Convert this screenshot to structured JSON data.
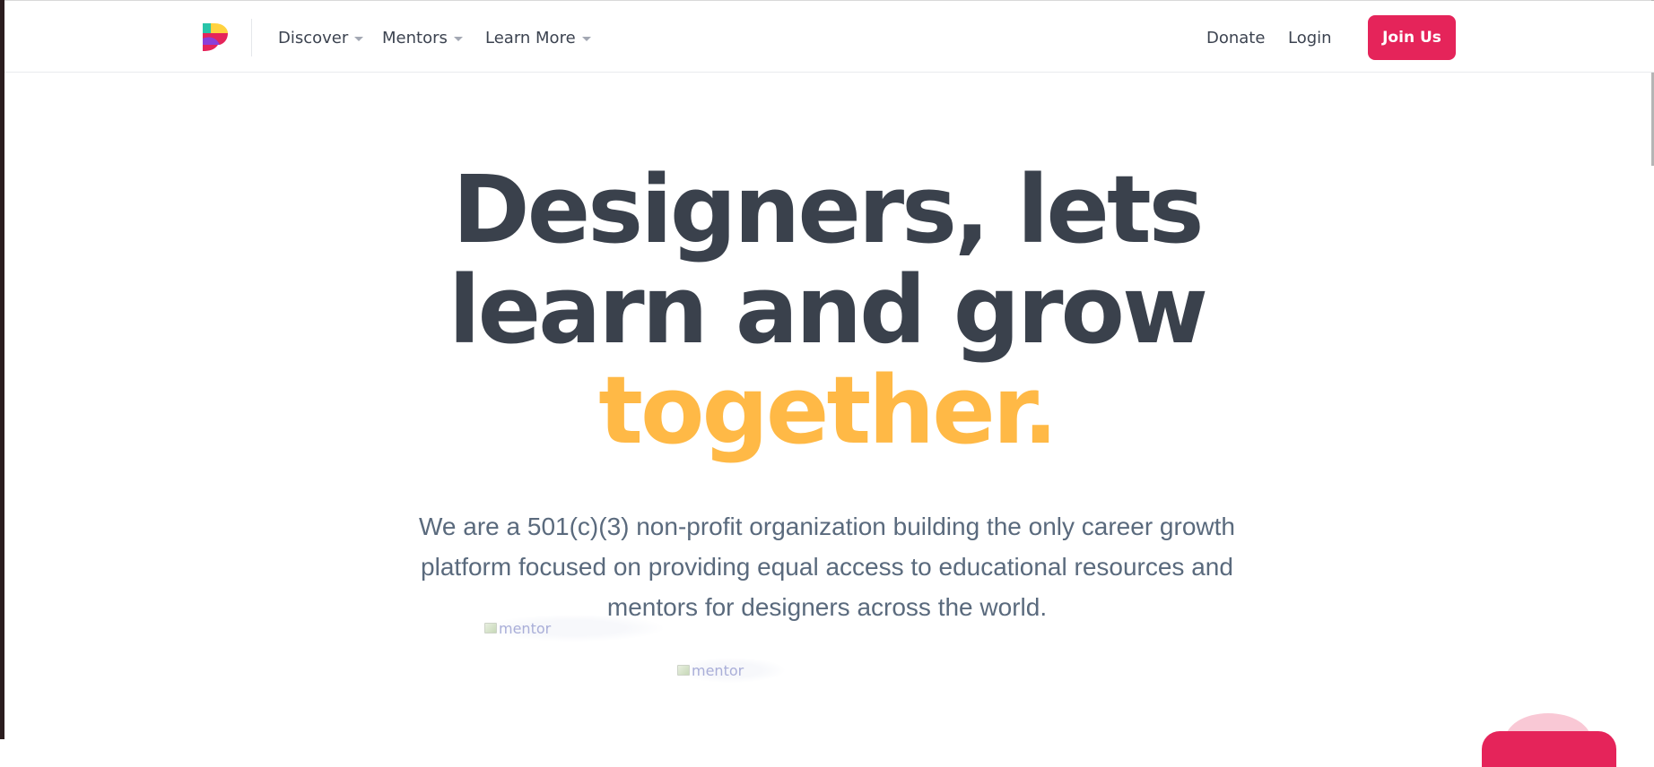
{
  "nav": {
    "logo_alt": "logo",
    "items": [
      {
        "label": "Discover",
        "has_dropdown": true
      },
      {
        "label": "Mentors",
        "has_dropdown": true
      },
      {
        "label": "Learn More",
        "has_dropdown": true
      }
    ],
    "donate_label": "Donate",
    "login_label": "Login",
    "join_label": "Join Us"
  },
  "hero": {
    "title_line1": "Designers, lets",
    "title_line2": "learn and grow",
    "title_accent": "together.",
    "subtitle": "We are a 501(c)(3) non-profit organization building the only career growth platform focused on providing equal access to educational resources and mentors for designers across the world.",
    "mentor_images": [
      {
        "alt": "mentor"
      },
      {
        "alt": "mentor"
      }
    ]
  },
  "colors": {
    "accent_pink": "#e5245a",
    "accent_yellow": "#ffb946",
    "heading": "#3a414c",
    "body_text": "#5a6a7d",
    "nav_text": "#3c4350"
  }
}
